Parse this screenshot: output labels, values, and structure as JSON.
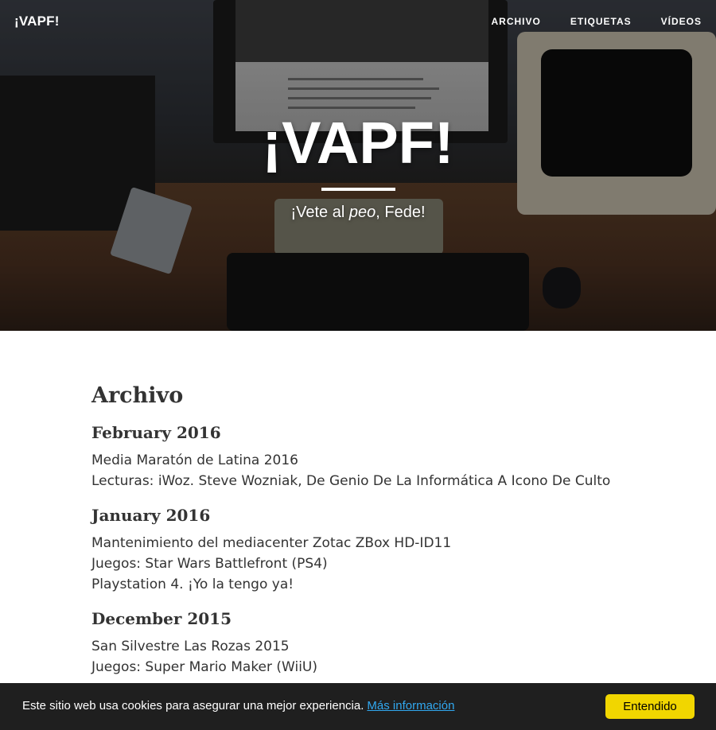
{
  "nav": {
    "brand": "¡VAPF!",
    "links": [
      "ARCHIVO",
      "ETIQUETAS",
      "VÍDEOS"
    ]
  },
  "hero": {
    "title": "¡VAPF!",
    "subtitle_before": "¡Vete al ",
    "subtitle_em": "peo",
    "subtitle_after": ", Fede!"
  },
  "archive": {
    "heading": "Archivo",
    "months": [
      {
        "title": "February 2016",
        "posts": [
          "Media Maratón de Latina 2016",
          "Lecturas: iWoz. Steve Wozniak, De Genio De La Informática A Icono De Culto"
        ]
      },
      {
        "title": "January 2016",
        "posts": [
          "Mantenimiento del mediacenter Zotac ZBox HD-ID11",
          "Juegos: Star Wars Battlefront (PS4)",
          "Playstation 4. ¡Yo la tengo ya!"
        ]
      },
      {
        "title": "December 2015",
        "posts": [
          "San Silvestre Las Rozas 2015",
          "Juegos: Super Mario Maker (WiiU)"
        ]
      }
    ]
  },
  "cookie": {
    "text": "Este sitio web usa cookies para asegurar una mejor experiencia.",
    "link": "Más información",
    "button": "Entendido"
  }
}
